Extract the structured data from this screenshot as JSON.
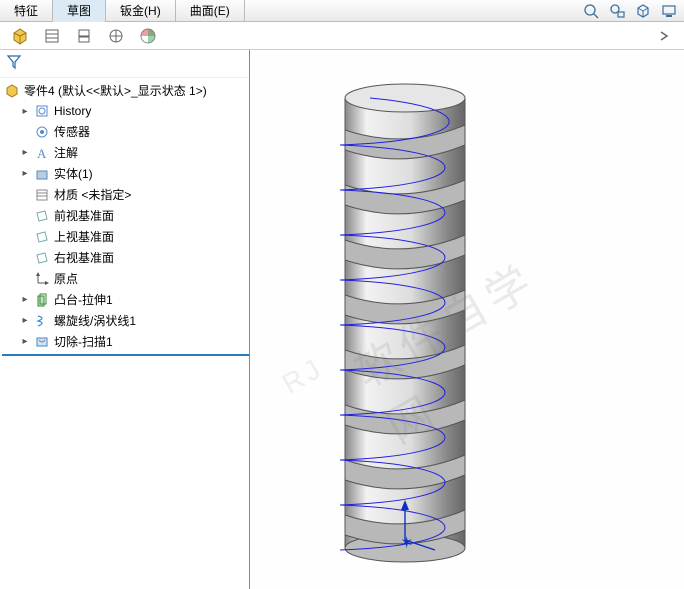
{
  "tabs": {
    "feature": "特征",
    "sketch": "草图",
    "sheetmetal": "钣金(H)",
    "surface": "曲面(E)"
  },
  "tree": {
    "root": "零件4 (默认<<默认>_显示状态 1>)",
    "history": "History",
    "sensors": "传感器",
    "annotations": "注解",
    "solids": "实体(1)",
    "material": "材质 <未指定>",
    "frontPlane": "前视基准面",
    "topPlane": "上视基准面",
    "rightPlane": "右视基准面",
    "origin": "原点",
    "bossExtrude": "凸台-拉伸1",
    "helix": "螺旋线/涡状线1",
    "cutSweep": "切除-扫描1"
  },
  "watermark": {
    "main": "软件自学网",
    "sub": "RJ"
  }
}
